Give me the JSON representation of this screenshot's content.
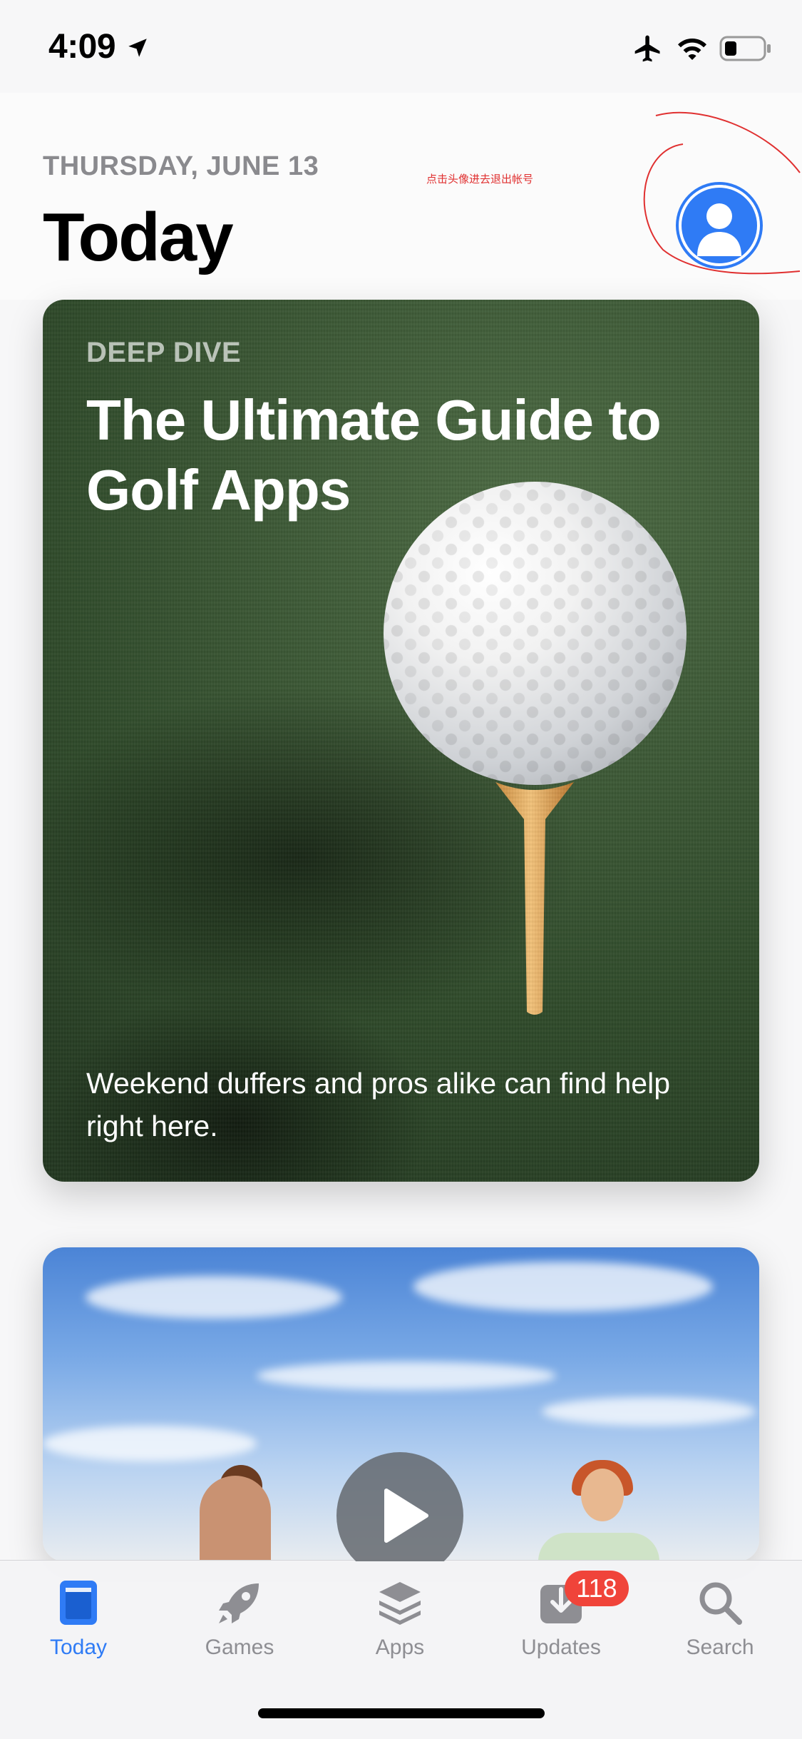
{
  "status_bar": {
    "time": "4:09",
    "icons": [
      "location-arrow-icon",
      "airplane-icon",
      "wifi-icon",
      "battery-icon"
    ]
  },
  "header": {
    "date": "THURSDAY, JUNE 13",
    "title": "Today",
    "annotation_note": "点击头像进去退出帐号",
    "avatar_icon": "person-avatar-icon"
  },
  "cards": [
    {
      "eyebrow": "DEEP DIVE",
      "title": "The Ultimate Guide to Golf Apps",
      "description": "Weekend duffers and pros alike can find help right here."
    },
    {
      "play_icon": "play-icon"
    }
  ],
  "tabbar": {
    "tabs": [
      {
        "label": "Today",
        "icon": "today-icon",
        "active": true
      },
      {
        "label": "Games",
        "icon": "rocket-icon",
        "active": false
      },
      {
        "label": "Apps",
        "icon": "layers-icon",
        "active": false
      },
      {
        "label": "Updates",
        "icon": "download-icon",
        "active": false,
        "badge": "118"
      },
      {
        "label": "Search",
        "icon": "search-icon",
        "active": false
      }
    ]
  },
  "colors": {
    "accent": "#2f7bf5",
    "badge": "#f0443a",
    "inactive": "#8e8e93"
  }
}
